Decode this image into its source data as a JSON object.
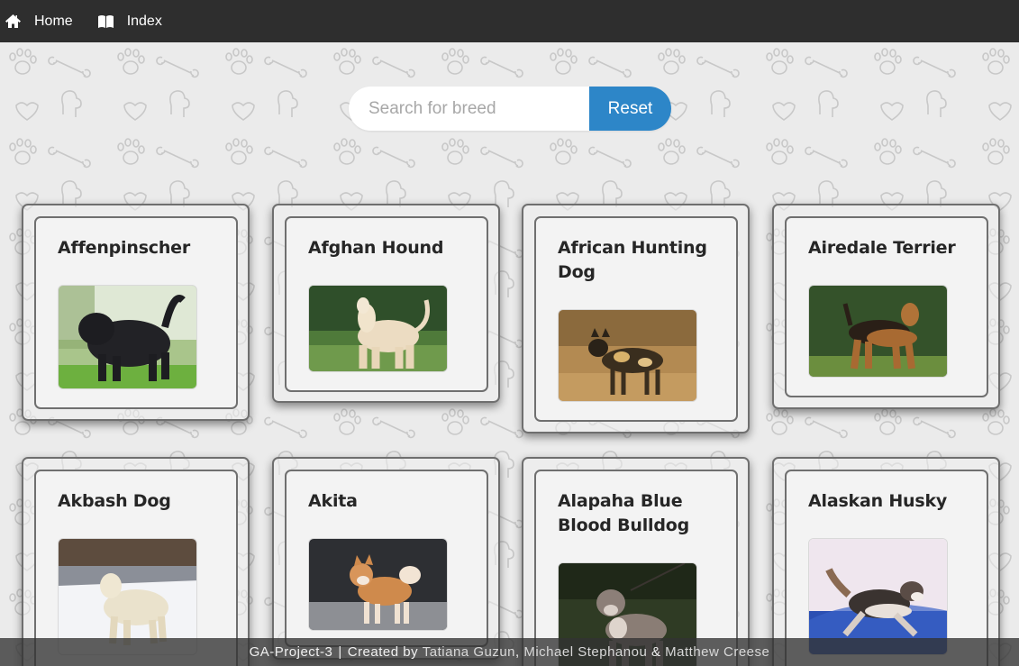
{
  "nav": {
    "home": {
      "label": "Home",
      "icon": "home-icon"
    },
    "index": {
      "label": "Index",
      "icon": "book-icon"
    }
  },
  "search": {
    "placeholder": "Search for breed",
    "value": "",
    "reset_label": "Reset"
  },
  "colors": {
    "navbar": "#2e2e2e",
    "accent": "#2d86c8",
    "card_border": "#6f6f6f",
    "background": "#ebebeb"
  },
  "breeds": [
    {
      "name": "Affenpinscher",
      "image": "black shaggy dog on grass"
    },
    {
      "name": "Afghan Hound",
      "image": "long-haired cream dog on lawn"
    },
    {
      "name": "African Hunting Dog",
      "image": "spotted wild dog in dry grass"
    },
    {
      "name": "Airedale Terrier",
      "image": "tan and black terrier in front of hedge"
    },
    {
      "name": "Akbash Dog",
      "image": "white dog in snow"
    },
    {
      "name": "Akita",
      "image": "red and white akita on path"
    },
    {
      "name": "Alapaha Blue Blood Bulldog",
      "image": "grey bulldog in forest"
    },
    {
      "name": "Alaskan Husky",
      "image": "husky running in snow"
    }
  ],
  "footer": {
    "project": "GA-Project-3",
    "separator": "|",
    "created_by": "Created by",
    "authors": [
      "Tatiana Guzun",
      "Michael Stephanou",
      "Matthew Creese"
    ],
    "joiner": ",",
    "ampersand": "&"
  }
}
